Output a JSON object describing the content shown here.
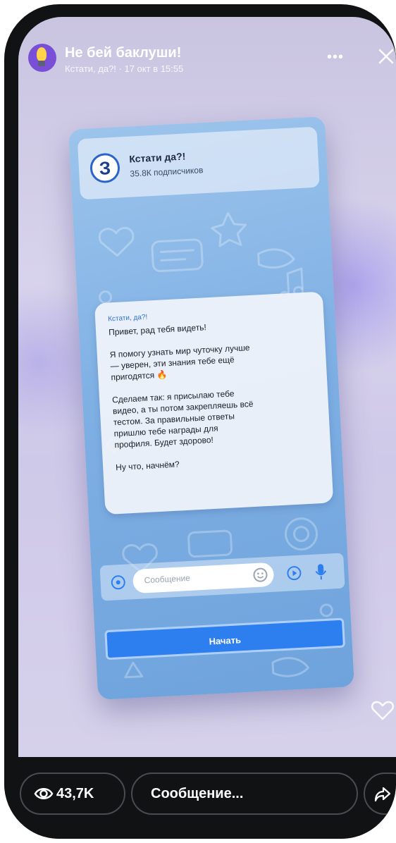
{
  "story": {
    "channel_title": "Не бей баклуши!",
    "subtitle": "Кстати, да?! · 17 окт в 15:55",
    "more_label": "•••"
  },
  "card": {
    "channel_name": "Кстати да?!",
    "subscribers": "35.8К подписчиков",
    "logo_letter": "З",
    "message": {
      "sender": "Кстати, да?!",
      "text": "Привет, рад тебя видеть!\n\nЯ помогу узнать мир чуточку лучше — уверен, эти знания тебе ещё пригодятся 🔥\n\nСделаем так: я присылаю тебе видео, а ты потом закрепляешь всё тестом. За правильные ответы пришлю тебе награды для профиля. Будет здорово!\n\nНу что, начнём?"
    },
    "input_placeholder": "Сообщение",
    "start_label": "Начать"
  },
  "bottom_bar": {
    "views": "43,7K",
    "reply_placeholder": "Сообщение..."
  },
  "colors": {
    "accent": "#2d7ff0",
    "card_bg": "#7fb0e4",
    "bar_bg": "#111214"
  }
}
